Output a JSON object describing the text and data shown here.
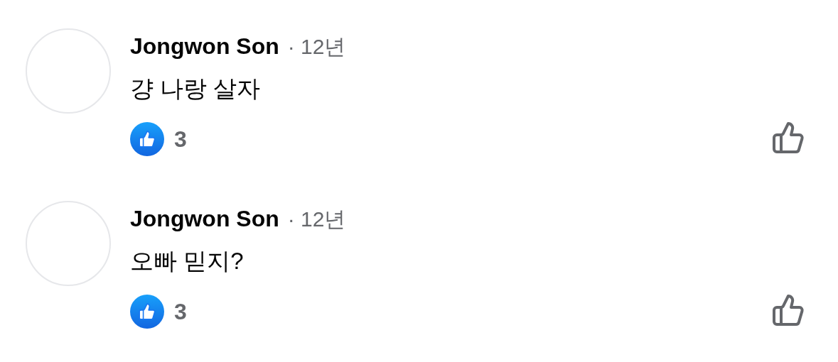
{
  "comments": [
    {
      "author": "Jongwon Son",
      "time": "· 12년",
      "text": "걍 나랑 살자",
      "reaction_count": "3"
    },
    {
      "author": "Jongwon Son",
      "time": "· 12년",
      "text": "오빠 믿지?",
      "reaction_count": "3"
    }
  ]
}
